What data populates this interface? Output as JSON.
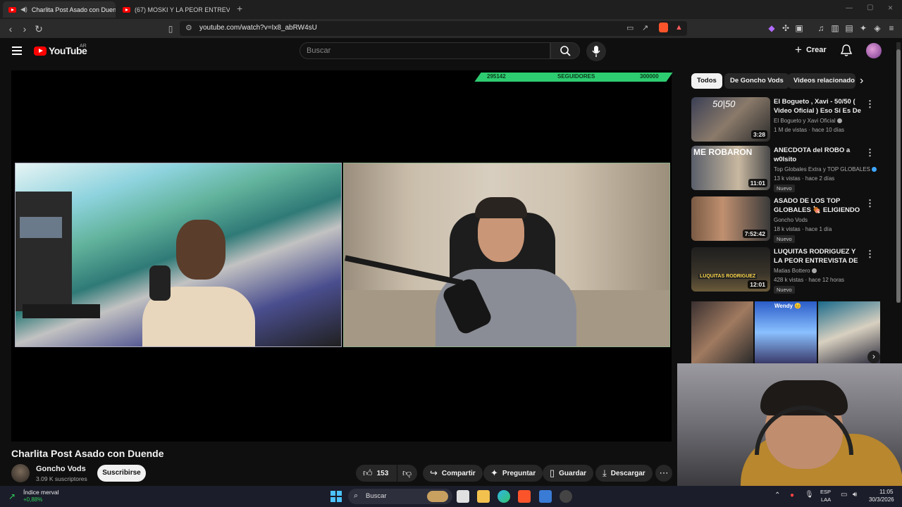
{
  "browser": {
    "tabs": [
      {
        "label": "Charlita Post Asado con Duen",
        "active": true
      },
      {
        "label": "(67) MOSKI Y LA PEOR ENTREVISTA D",
        "active": false
      }
    ],
    "url": "youtube.com/watch?v=Ix8_abRW4sU"
  },
  "youtube": {
    "logo": "YouTube",
    "region": "AR",
    "search_placeholder": "Buscar",
    "create_label": "Crear"
  },
  "stream_overlay": {
    "current": "295142",
    "label": "SEGUIDORES",
    "goal": "300000",
    "progress": 0.98
  },
  "video": {
    "title": "Charlita Post Asado con Duende",
    "channel": "Goncho Vods",
    "subscribers": "3.09 K suscriptores",
    "subscribe_label": "Suscribirse",
    "likes": "153",
    "share_label": "Compartir",
    "ask_label": "Preguntar",
    "save_label": "Guardar",
    "download_label": "Descargar"
  },
  "sidebar": {
    "chips": [
      "Todos",
      "De Goncho Vods",
      "Videos relacionado"
    ],
    "videos": [
      {
        "title": "El Bogueto , Xavi - 50/50 ( Video Oficial ) Eso Sí Es De ...",
        "channel": "El Bogueto y Xavi Oficial",
        "meta": "1 M de vistas · hace 10 días",
        "duration": "3:28",
        "badge": "",
        "thumb_text": "50|50"
      },
      {
        "title": "ANECDOTA del ROBO a w0lsito",
        "channel": "Top Globales Extra y TOP GLOBALES",
        "meta": "13 k vistas · hace 2 días",
        "duration": "11:01",
        "badge": "Nuevo",
        "thumb_text": "ME ROBARON"
      },
      {
        "title": "ASADO DE LOS TOP GLOBALES 🍖 ELIGIENDO L...",
        "channel": "Goncho Vods",
        "meta": "18 k vistas · hace 1 día",
        "duration": "7:52:42",
        "badge": "Nuevo",
        "thumb_text": ""
      },
      {
        "title": "LUQUITAS RODRIGUEZ Y LA PEOR ENTREVISTA DE SU ...",
        "channel": "Matias Bottero",
        "meta": "428 k vistas · hace 12 horas",
        "duration": "12:01",
        "badge": "Nuevo",
        "thumb_text": "LUQUITAS RODRIGUEZ"
      }
    ],
    "shorts_label": "Wendy 😊"
  },
  "taskbar": {
    "widget_title": "Índice merval",
    "widget_value": "+0,88%",
    "search": "Buscar",
    "lang1": "ESP",
    "lang2": "LAA",
    "time": "11:05",
    "date": "30/3/2026"
  }
}
